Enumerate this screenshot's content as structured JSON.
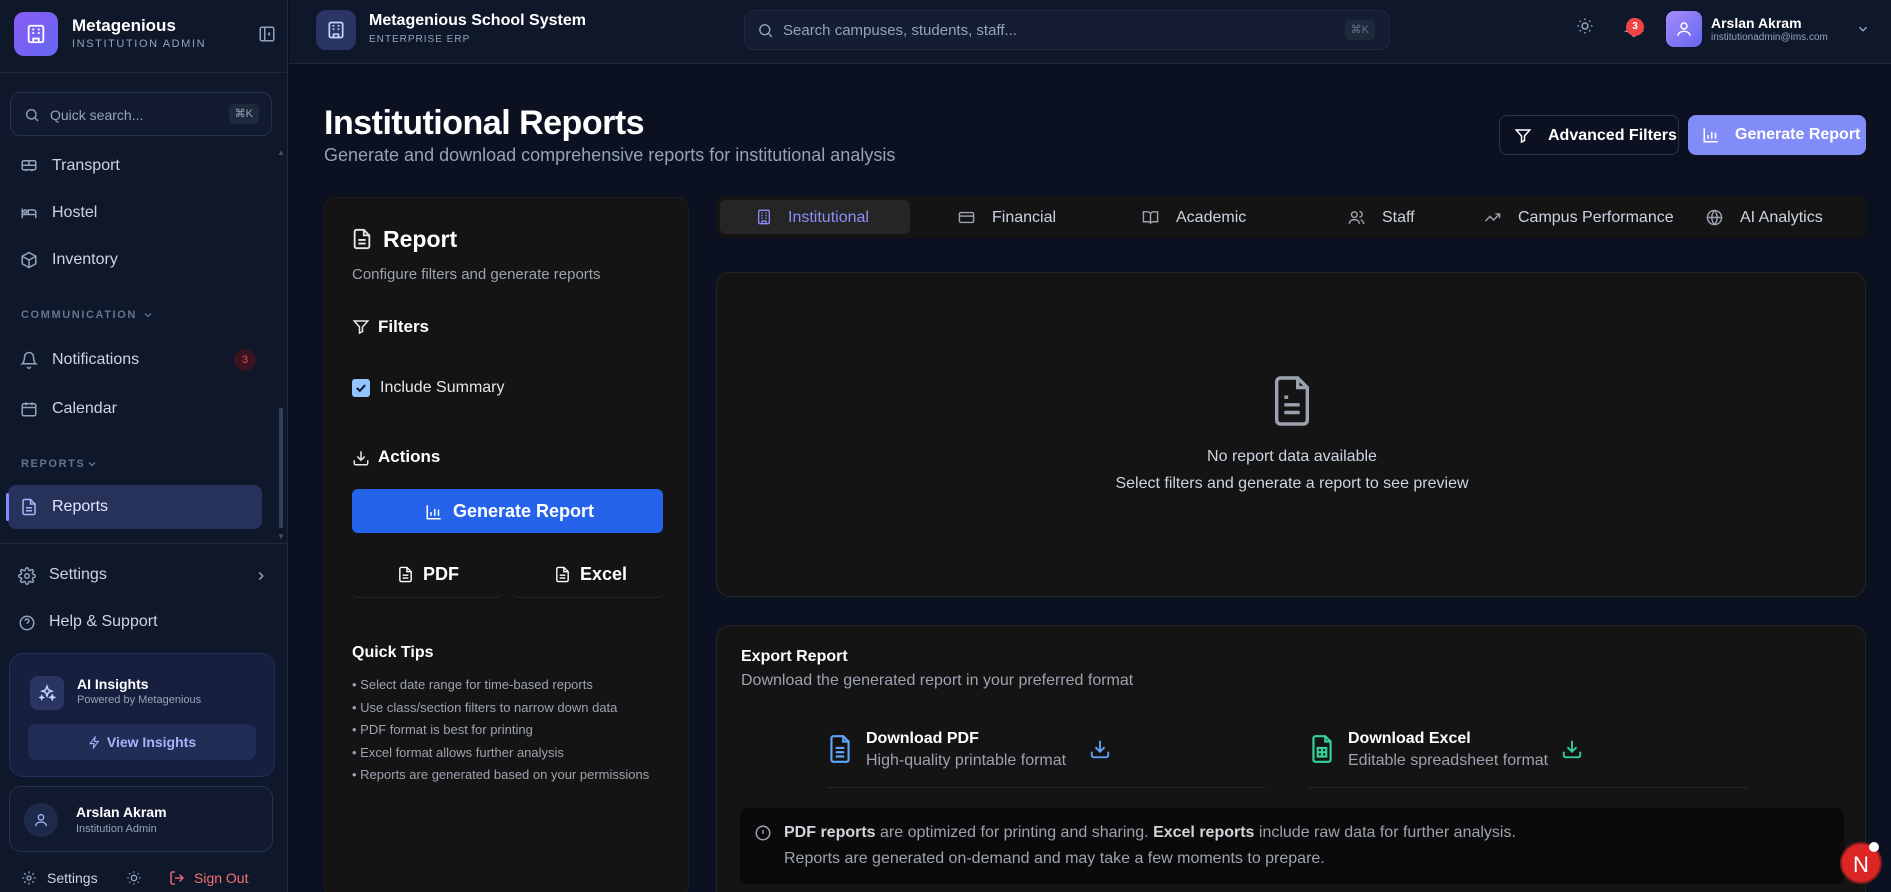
{
  "brand": {
    "name": "Metagenious",
    "subtitle": "INSTITUTION ADMIN"
  },
  "sidebar": {
    "quick_search": {
      "placeholder": "Quick search...",
      "shortcut": "⌘K"
    },
    "items": [
      {
        "label": "Transport",
        "icon": "bus-icon"
      },
      {
        "label": "Hostel",
        "icon": "bed-icon"
      },
      {
        "label": "Inventory",
        "icon": "package-icon"
      }
    ],
    "sections": [
      {
        "title": "COMMUNICATION",
        "items": [
          {
            "label": "Notifications",
            "icon": "bell-icon",
            "badge": "3"
          },
          {
            "label": "Calendar",
            "icon": "calendar-icon"
          }
        ]
      },
      {
        "title": "REPORTS",
        "items": [
          {
            "label": "Reports",
            "icon": "file-text-icon",
            "active": true
          }
        ]
      }
    ],
    "settings_label": "Settings",
    "help_label": "Help & Support",
    "ai_card": {
      "title": "AI Insights",
      "subtitle": "Powered by Metagenious",
      "button": "View Insights"
    },
    "user": {
      "name": "Arslan Akram",
      "role": "Institution Admin"
    },
    "footer": {
      "settings": "Settings",
      "sign_out": "Sign Out"
    }
  },
  "topbar": {
    "title": "Metagenious School System",
    "subtitle": "ENTERPRISE ERP",
    "search": {
      "placeholder": "Search campuses, students, staff...",
      "shortcut": "⌘K"
    },
    "notification_count": "3",
    "user": {
      "name": "Arslan Akram",
      "email": "institutionadmin@ims.com"
    }
  },
  "page": {
    "title": "Institutional Reports",
    "subtitle": "Generate and download comprehensive reports for institutional analysis",
    "advanced_filters": "Advanced Filters",
    "generate_report": "Generate Report"
  },
  "left_panel": {
    "title": "Report",
    "subtitle": "Configure filters and generate reports",
    "filters_title": "Filters",
    "include_summary": {
      "label": "Include Summary",
      "checked": true
    },
    "actions_title": "Actions",
    "generate_button": "Generate Report",
    "pdf_button": "PDF",
    "excel_button": "Excel",
    "tips_title": "Quick Tips",
    "tips": [
      "• Select date range for time-based reports",
      "• Use class/section filters to narrow down data",
      "• PDF format is best for printing",
      "• Excel format allows further analysis",
      "• Reports are generated based on your permissions"
    ]
  },
  "tabs": [
    {
      "label": "Institutional",
      "icon": "building-icon",
      "active": true
    },
    {
      "label": "Financial",
      "icon": "credit-card-icon"
    },
    {
      "label": "Academic",
      "icon": "book-open-icon"
    },
    {
      "label": "Staff",
      "icon": "users-icon"
    },
    {
      "label": "Campus Performance",
      "icon": "trending-up-icon"
    },
    {
      "label": "AI Analytics",
      "icon": "globe-icon"
    }
  ],
  "preview": {
    "empty_title": "No report data available",
    "empty_subtitle": "Select filters and generate a report to see preview"
  },
  "export": {
    "title": "Export Report",
    "subtitle": "Download the generated report in your preferred format",
    "pdf": {
      "title": "Download PDF",
      "subtitle": "High-quality printable format"
    },
    "excel": {
      "title": "Download Excel",
      "subtitle": "Editable spreadsheet format"
    },
    "note": {
      "pdf_bold": "PDF reports",
      "pdf_text": " are optimized for printing and sharing. ",
      "excel_bold": "Excel reports",
      "excel_text": " include raw data for further analysis.",
      "line2": "Reports are generated on-demand and may take a few moments to prepare."
    }
  },
  "floating_badge": "N",
  "colors": {
    "accent": "#818cf8",
    "primary_button": "#2563eb",
    "danger": "#ef4444",
    "background": "#0b1120"
  }
}
